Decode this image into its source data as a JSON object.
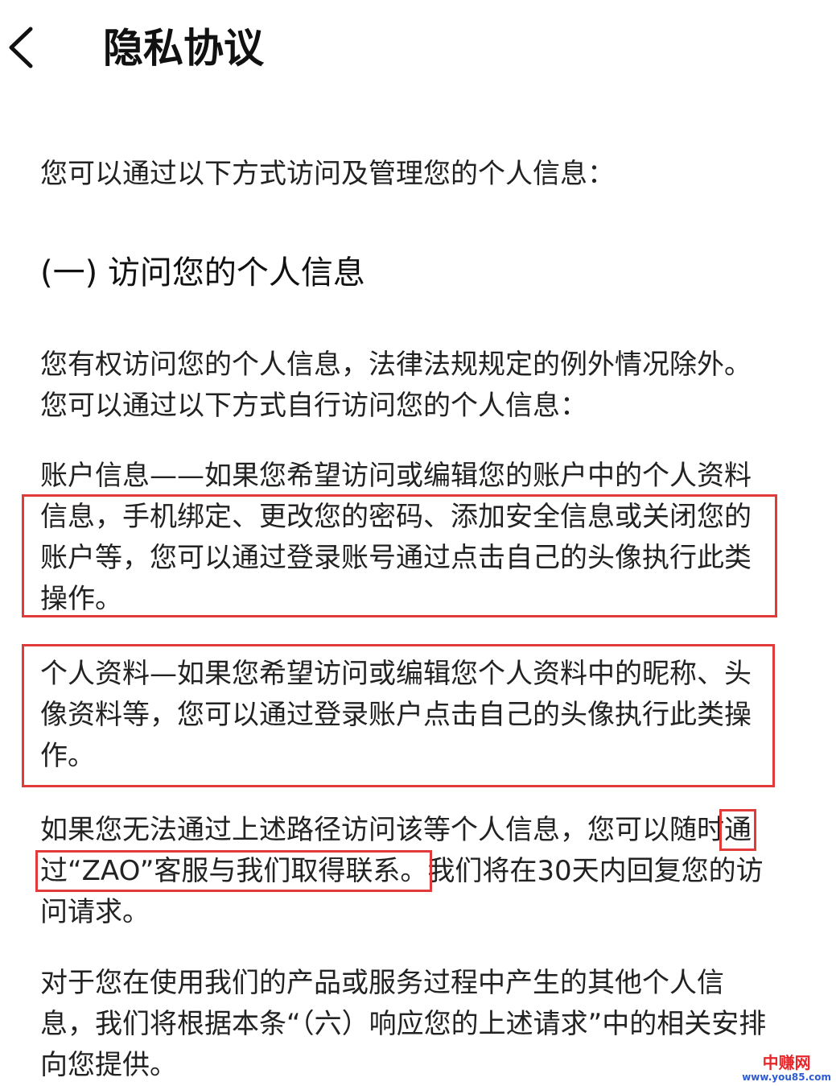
{
  "header": {
    "back_icon": "chevron-left-icon",
    "title": "隐私协议"
  },
  "content": {
    "intro": "您可以通过以下方式访问及管理您的个人信息：",
    "section_heading": "(一) 访问您的个人信息",
    "p1": "您有权访问您的个人信息，法律法规规定的例外情况除外。您可以通过以下方式自行访问您的个人信息：",
    "p2": "账户信息——如果您希望访问或编辑您的账户中的个人资料信息，手机绑定、更改您的密码、添加安全信息或关闭您的账户等，您可以通过登录账号通过点击自己的头像执行此类操作。",
    "p3": "个人资料—如果您希望访问或编辑您个人资料中的昵称、头像资料等，您可以通过登录账户点击自己的头像执行此类操作。",
    "p4_part1": "如果您无法通过上述路径访问该等个人信息，您可以随时",
    "p4_highlight": "通过“ZAO”客服与我们取得联系。",
    "p4_part2": "我们将在30天内回复您的访问请求。",
    "p5": "对于您在使用我们的产品或服务过程中产生的其他个人信息，我们将根据本条“（六）响应您的上述请求”中的相关安排向您提供。"
  },
  "watermark": {
    "name": "中赚网",
    "url": "www.you85.com"
  },
  "colors": {
    "highlight_border": "#e03a3a",
    "watermark_red": "#e8262a",
    "watermark_blue": "#2f5bd0"
  }
}
